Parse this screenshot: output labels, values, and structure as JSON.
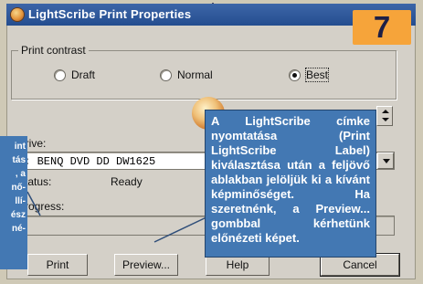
{
  "window": {
    "title": "LightScribe Print Properties"
  },
  "step_badge": "7",
  "print_contrast": {
    "label": "Print contrast",
    "options": [
      "Draft",
      "Normal",
      "Best"
    ],
    "selected": "Best"
  },
  "drive": {
    "label": "Drive:",
    "value": "E: BENQ    DVD DD DW1625"
  },
  "status": {
    "label": "Status:",
    "value": "Ready"
  },
  "progress": {
    "label": "Progress:"
  },
  "buttons": {
    "print": "Print",
    "preview": "Preview...",
    "help": "Help",
    "cancel": "Cancel"
  },
  "callout_right": {
    "text": "A LightScribe címke nyomtatása (Print LightScribe Label) kiválasztása után a feljövő ablakban jelöljük ki a kívánt képminőséget. Ha szeretnénk, a Preview... gombbal kérhetünk előnézeti képet."
  },
  "callout_left": {
    "lines": [
      "int",
      "tás",
      ", a",
      "nő-",
      "llí-",
      "ész",
      "né-"
    ]
  },
  "colors": {
    "titlebar": "#2d5699",
    "callout": "#4378b3",
    "badge": "#f6a43a",
    "dialog": "#d4d0c8"
  }
}
